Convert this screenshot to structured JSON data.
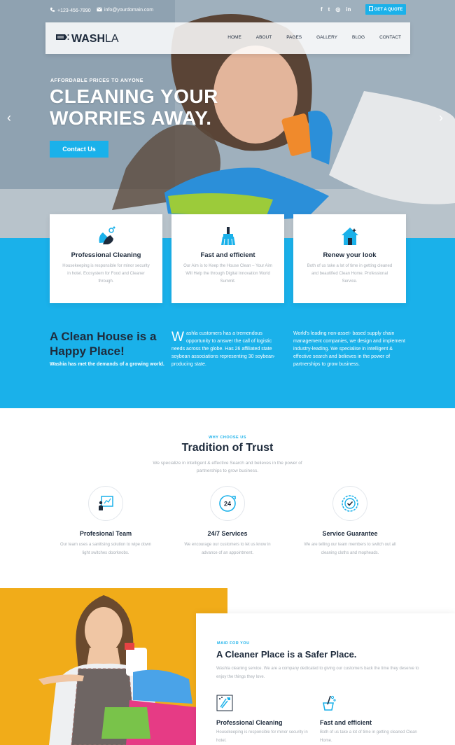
{
  "colors": {
    "accent": "#1ab1ea",
    "dark": "#1e2b3c",
    "muted": "#a7adb4",
    "yellow": "#f1ac19"
  },
  "topbar": {
    "phone": "+123-456-7890",
    "email": "info@yourdomain.com",
    "social_icons": [
      "facebook-icon",
      "twitter-icon",
      "instagram-icon",
      "linkedin-icon"
    ],
    "social_glyphs": [
      "f",
      "t",
      "◎",
      "in"
    ],
    "quote_label": "GET A QUOTE"
  },
  "nav": {
    "logo_bold": "WASH",
    "logo_light": "LA",
    "items": [
      "HOME",
      "ABOUT",
      "PAGES",
      "GALLERY",
      "BLOG",
      "CONTACT"
    ]
  },
  "hero": {
    "tagline": "AFFORDABLE PRICES TO ANYONE",
    "line1": "CLEANING YOUR",
    "line2": "WORRIES AWAY.",
    "button": "Contact Us",
    "prev": "‹",
    "next": "›"
  },
  "cards": [
    {
      "icon": "hands-washing-icon",
      "title": "Professional Cleaning",
      "text": "Housekeeping is responsible for minor security in hotel. Ecosystem for Food and Cleaner through."
    },
    {
      "icon": "broom-icon",
      "title": "Fast and efficient",
      "text": "Our Aim is to Keep the House Clean – Your Aim Will Help the through Digital Innovation World Summit."
    },
    {
      "icon": "house-clean-icon",
      "title": "Renew your look",
      "text": "Both of us take a lot of time in getting cleaned and beautified Clean Home. Professional Service."
    }
  ],
  "about": {
    "title": "A Clean House is a Happy Place!",
    "subtitle": "Washia has met the demands of a growing world.",
    "dropcap": "W",
    "col2": "ashla customers has a tremendous opportunity to answer the call of logistic needs across the globe. Has 26 affiliated state soybean associations representing 30 soybean-producing state.",
    "col3": "World's leading non-asset- based supply chain management companies, we design and implement industry-leading. We specialise in intelligent & effective search and believes in the power of partnerships to grow business."
  },
  "why": {
    "label": "WHY CHOOSE US",
    "title": "Tradition of Trust",
    "subtitle": "We specialize in intelligent & effective Search and believes in the power of partnerships to grow business."
  },
  "features": [
    {
      "icon": "team-board-icon",
      "title": "Profesional Team",
      "text": "Our team uses a sanitising solution to wipe down light switches doorknobs."
    },
    {
      "icon": "24-hour-service-icon",
      "title": "24/7 Services",
      "text": "We encourage our customers to let us know in advance of an appointment."
    },
    {
      "icon": "guarantee-badge-icon",
      "title": "Service Guarantee",
      "text": "We are telling our team members to switch out all cleaning cloths and mopheads."
    }
  ],
  "maid": {
    "label": "MAID FOR YOU",
    "title": "A Cleaner Place is a Safer Place.",
    "text": "Washla cleaning service. We are a company dedicated to giving our customers back the time they deserve to enjoy the things they love.",
    "items": [
      {
        "icon": "cleaning-spray-icon",
        "title": "Professional Cleaning",
        "text": "Housekeeping is responsible for minor security in hotel."
      },
      {
        "icon": "mop-bucket-icon",
        "title": "Fast and efficient",
        "text": "Both of us take a lot of time in getting cleaned Clean Home."
      }
    ]
  }
}
